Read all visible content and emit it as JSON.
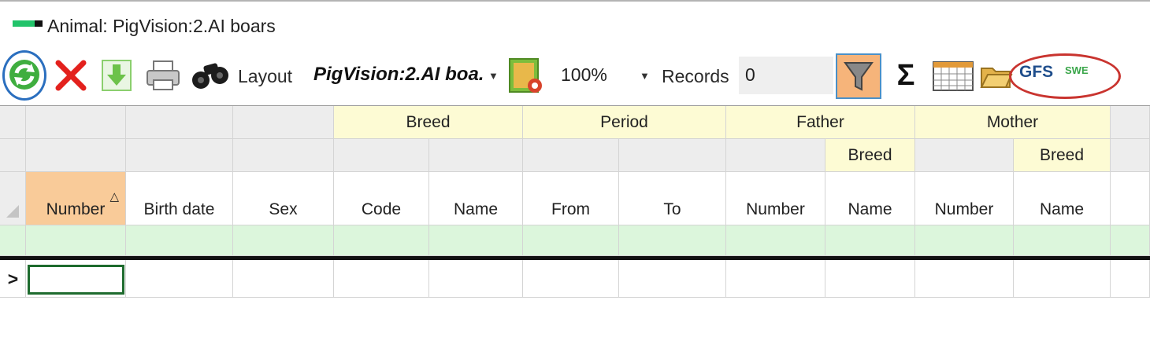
{
  "window": {
    "title": "Animal: PigVision:2.AI boars"
  },
  "toolbar": {
    "refresh_icon": "refresh-icon",
    "delete_icon": "delete-icon",
    "export_icon": "export-download-icon",
    "print_icon": "printer-icon",
    "find_icon": "binoculars-icon",
    "layout_label": "Layout",
    "layout_value": "PigVision:2.AI boa.",
    "layout_settings_icon": "layout-settings-icon",
    "zoom_value": "100%",
    "records_label": "Records",
    "records_value": "0",
    "filter_icon": "funnel-icon",
    "sum_icon": "sigma-icon",
    "calendar_icon": "calendar-icon",
    "folder_icon": "folder-icon",
    "gfs_label": "GFS",
    "swe_label": "SWE"
  },
  "grid": {
    "groups": {
      "breed": "Breed",
      "period": "Period",
      "father": "Father",
      "mother": "Mother",
      "father_breed": "Breed",
      "mother_breed": "Breed"
    },
    "columns": {
      "number": "Number",
      "birth_date": "Birth date",
      "sex": "Sex",
      "breed_code": "Code",
      "breed_name": "Name",
      "period_from": "From",
      "period_to": "To",
      "father_number": "Number",
      "father_breed_name": "Name",
      "mother_number": "Number",
      "mother_breed_name": "Name"
    },
    "sort_indicator": "△",
    "row_indicator": ">"
  },
  "colors": {
    "accent_blue": "#2b6fbf",
    "highlight_red": "#c9342f",
    "sorted_column": "#f9cb99",
    "filter_row": "#dcf6dc",
    "group_header": "#fdfbd4"
  }
}
